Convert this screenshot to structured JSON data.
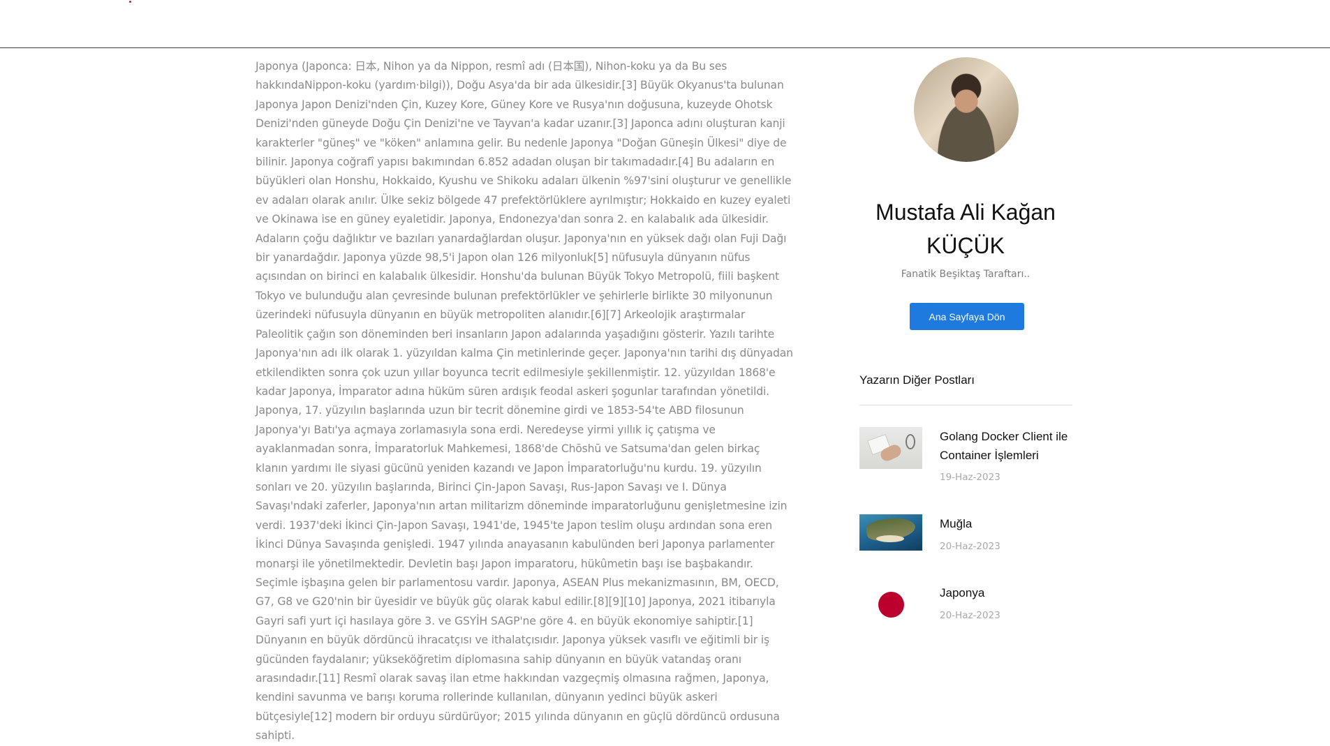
{
  "article": {
    "paragraph": "Japonya (Japonca: 日本, Nihon ya da Nippon, resmî adı (日本国), Nihon-koku ya da Bu ses hakkındaNippon-koku (yardım·bilgi)), Doğu Asya'da bir ada ülkesidir.[3] Büyük Okyanus'ta bulunan Japonya Japon Denizi'nden Çin, Kuzey Kore, Güney Kore ve Rusya'nın doğusuna, kuzeyde Ohotsk Denizi'nden güneyde Doğu Çin Denizi'ne ve Tayvan'a kadar uzanır.[3] Japonca adını oluşturan kanji karakterler \"güneş\" ve \"köken\" anlamına gelir. Bu nedenle Japonya \"Doğan Güneşin Ülkesi\" diye de bilinir. Japonya coğrafî yapısı bakımından 6.852 adadan oluşan bir takımadadır.[4] Bu adaların en büyükleri olan Honshu, Hokkaido, Kyushu ve Shikoku adaları ülkenin %97'sini oluşturur ve genellikle ev adaları olarak anılır. Ülke sekiz bölgede 47 prefektörlüklere ayrılmıştır; Hokkaido en kuzey eyaleti ve Okinawa ise en güney eyaletidir. Japonya, Endonezya'dan sonra 2. en kalabalık ada ülkesidir. Adaların çoğu dağlıktır ve bazıları yanardağlardan oluşur. Japonya'nın en yüksek dağı olan Fuji Dağı bir yanardağdır. Japonya yüzde 98,5'i Japon olan 126 milyonluk[5] nüfusuyla dünyanın nüfus açısından on birinci en kalabalık ülkesidir. Honshu'da bulunan Büyük Tokyo Metropolü, fiili başkent Tokyo ve bulunduğu alan çevresinde bulunan prefektörlükler ve şehirlerle birlikte 30 milyonunun üzerindeki nüfusuyla dünyanın en büyük metropoliten alanıdır.[6][7] Arkeolojik araştırmalar Paleolitik çağın son döneminden beri insanların Japon adalarında yaşadığını gösterir. Yazılı tarihte Japonya'nın adı ilk olarak 1. yüzyıldan kalma Çin metinlerinde geçer. Japonya'nın tarihi dış dünyadan etkilendikten sonra çok uzun yıllar boyunca tecrit edilmesiyle şekillenmiştir. 12. yüzyıldan 1868'e kadar Japonya, İmparator adına hüküm süren ardışık feodal askeri şogunlar tarafından yönetildi. Japonya, 17. yüzyılın başlarında uzun bir tecrit dönemine girdi ve 1853-54'te ABD filosunun Japonya'yı Batı'ya açmaya zorlamasıyla sona erdi. Neredeyse yirmi yıllık iç çatışma ve ayaklanmadan sonra, İmparatorluk Mahkemesi, 1868'de Chōshū ve Satsuma'dan gelen birkaç klanın yardımı ile siyasi gücünü yeniden kazandı ve Japon İmparatorluğu'nu kurdu. 19. yüzyılın sonları ve 20. yüzyılın başlarında, Birinci Çin-Japon Savaşı, Rus-Japon Savaşı ve I. Dünya Savaşı'ndaki zaferler, Japonya'nın artan militarizm döneminde imparatorluğunu genişletmesine izin verdi. 1937'deki İkinci Çin-Japon Savaşı, 1941'de, 1945'te Japon teslim oluşu ardından sona eren İkinci Dünya Savaşında genişledi. 1947 yılında anayasanın kabulünden beri Japonya parlamenter monarşi ile yönetilmektedir. Devletin başı Japon imparatoru, hükûmetin başı ise başbakandır. Seçimle işbaşına gelen bir parlamentosu vardır. Japonya, ASEAN Plus mekanizmasının, BM, OECD, G7, G8 ve G20'nin bir üyesidir ve büyük güç olarak kabul edilir.[8][9][10] Japonya, 2021 itibarıyla Gayri safi yurt içi hasılaya göre 3. ve GSYİH SAGP'ne göre 4. en büyük ekonomiye sahiptir.[1] Dünyanın en büyük dördüncü ihracatçısı ve ithalatçısıdır. Japonya yüksek vasıflı ve eğitimli bir iş gücünden faydalanır; yükseköğretim diplomasına sahip dünyanın en büyük vatandaş oranı arasındadır.[11] Resmî olarak savaş ilan etme hakkından vazgeçmiş olmasına rağmen, Japonya, kendini savunma ve barışı koruma rollerinde kullanılan, dünyanın yedinci büyük askeri bütçesiyle[12] modern bir orduyu sürdürüyor; 2015 yılında dünyanın en güçlü dördüncü ordusuna sahipti."
  },
  "author": {
    "name": "Mustafa Ali Kağan KÜÇÜK",
    "bio": "Fanatik Beşiktaş Taraftarı..",
    "home_button": "Ana Sayfaya Dön"
  },
  "other_posts": {
    "heading": "Yazarın Diğer Postları",
    "items": [
      {
        "title": "Golang Docker Client ile Container İşlemleri",
        "date": "19-Haz-2023"
      },
      {
        "title": "Muğla",
        "date": "20-Haz-2023"
      },
      {
        "title": "Japonya",
        "date": "20-Haz-2023"
      }
    ]
  },
  "colors": {
    "accent": "#1f7ae0",
    "japan_red": "#bc002d"
  }
}
